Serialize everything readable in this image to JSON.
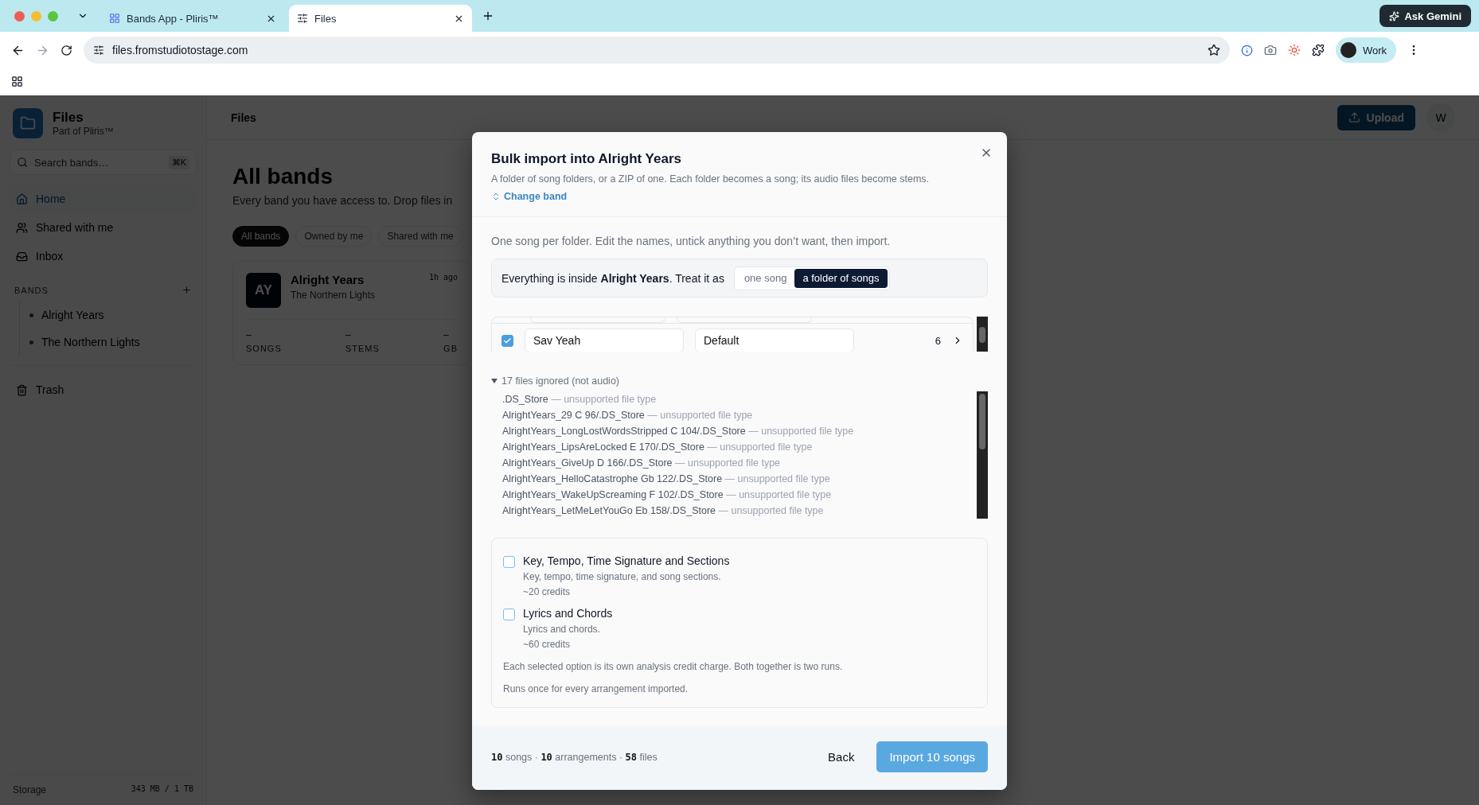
{
  "browser": {
    "tabs": [
      {
        "title": "Bands App - Pliris™",
        "selected": false
      },
      {
        "title": "Files",
        "selected": true
      }
    ],
    "url": "files.fromstudiotostage.com",
    "ask_gemini": "Ask Gemini",
    "profile": "Work"
  },
  "sidebar": {
    "title": "Files",
    "subtitle": "Part of Pliris™",
    "search_placeholder": "Search bands…",
    "shortcut": "⌘K",
    "nav": [
      {
        "label": "Home",
        "selected": true
      },
      {
        "label": "Shared with me",
        "selected": false
      },
      {
        "label": "Inbox",
        "selected": false
      }
    ],
    "bands_heading": "BANDS",
    "bands": [
      "Alright Years",
      "The Northern Lights"
    ],
    "trash": "Trash",
    "storage_label": "Storage",
    "storage_value": "343 MB / 1 TB"
  },
  "header": {
    "title": "Files",
    "upload": "Upload",
    "avatar": "W"
  },
  "main": {
    "title": "All bands",
    "subtitle": "Every band you have access to. Drop files in",
    "filters": [
      {
        "label": "All bands",
        "selected": true
      },
      {
        "label": "Owned by me",
        "selected": false
      },
      {
        "label": "Shared with me",
        "selected": false
      }
    ],
    "card": {
      "initials": "AY",
      "name": "Alright Years",
      "subtitle": "The Northern Lights",
      "time": "1h ago",
      "stats": [
        {
          "value": "–",
          "label": "SONGS"
        },
        {
          "value": "–",
          "label": "STEMS"
        },
        {
          "value": "–",
          "label": "GB"
        }
      ]
    }
  },
  "modal": {
    "title": "Bulk import into Alright Years",
    "description": "A folder of song folders, or a ZIP of one. Each folder becomes a song; its audio files become stems.",
    "change_band": "Change band",
    "intro": "One song per folder. Edit the names, untick anything you don’t want, then import.",
    "treat_as": {
      "text": "Everything is inside **Alright Years**. Treat it as",
      "options": [
        {
          "label": "one song",
          "selected": false
        },
        {
          "label": "a folder of songs",
          "selected": true
        }
      ]
    },
    "songs": [
      {
        "checked": true,
        "name": "Sav Yeah",
        "arrangement": "Default",
        "count": "6"
      }
    ],
    "ignored": {
      "summary": "17 files ignored (not audio)",
      "expanded": true,
      "files": [
        {
          "name": ".DS_Store",
          "reason": "— unsupported file type"
        },
        {
          "name": "AlrightYears_29 C 96/.DS_Store",
          "reason": "— unsupported file type"
        },
        {
          "name": "AlrightYears_LongLostWordsStripped C 104/.DS_Store",
          "reason": "— unsupported file type"
        },
        {
          "name": "AlrightYears_LipsAreLocked E 170/.DS_Store",
          "reason": "— unsupported file type"
        },
        {
          "name": "AlrightYears_GiveUp D 166/.DS_Store",
          "reason": "— unsupported file type"
        },
        {
          "name": "AlrightYears_HelloCatastrophe Gb 122/.DS_Store",
          "reason": "— unsupported file type"
        },
        {
          "name": "AlrightYears_WakeUpScreaming F 102/.DS_Store",
          "reason": "— unsupported file type"
        },
        {
          "name": "AlrightYears_LetMeLetYouGo Eb 158/.DS_Store",
          "reason": "— unsupported file type"
        }
      ]
    },
    "options": [
      {
        "title": "Key, Tempo, Time Signature and Sections",
        "description": "Key, tempo, time signature, and song sections.",
        "credits": "~20 credits",
        "checked": false
      },
      {
        "title": "Lyrics and Chords",
        "description": "Lyrics and chords.",
        "credits": "~60 credits",
        "checked": false
      }
    ],
    "notes": [
      "Each selected option is its own analysis credit charge. Both together is two runs.",
      "Runs once for every arrangement imported."
    ],
    "footer_summary": "**10** songs · **10** arrangements · **58** files",
    "back": "Back",
    "import": "Import 10 songs"
  }
}
